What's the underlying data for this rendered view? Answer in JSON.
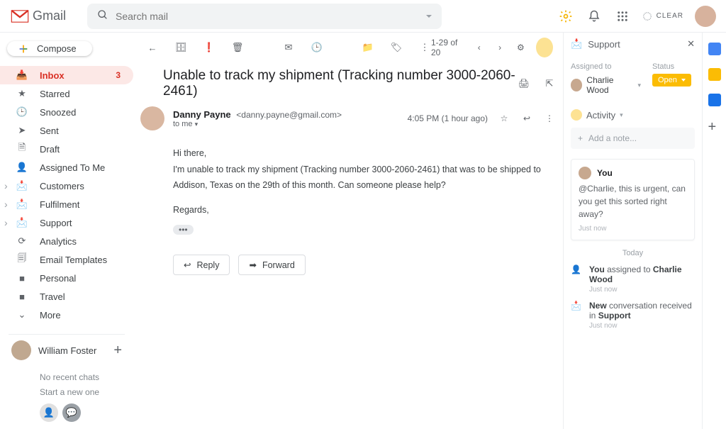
{
  "header": {
    "logo_text": "Gmail",
    "search_placeholder": "Search mail",
    "clear_label": "CLEAR"
  },
  "compose_label": "Compose",
  "sidebar": {
    "items": [
      {
        "label": "Inbox",
        "count": "3"
      },
      {
        "label": "Starred"
      },
      {
        "label": "Snoozed"
      },
      {
        "label": "Sent"
      },
      {
        "label": "Draft"
      },
      {
        "label": "Assigned To Me"
      },
      {
        "label": "Customers"
      },
      {
        "label": "Fulfilment"
      },
      {
        "label": "Support"
      },
      {
        "label": "Analytics"
      },
      {
        "label": "Email Templates"
      },
      {
        "label": "Personal"
      },
      {
        "label": "Travel"
      },
      {
        "label": "More"
      }
    ],
    "profile_name": "William Foster",
    "chats_line1": "No recent chats",
    "chats_line2": "Start a new one"
  },
  "toolbar": {
    "count_text": "1-29 of 20"
  },
  "message": {
    "subject": "Unable to track my shipment (Tracking number 3000-2060-2461)",
    "sender_name": "Danny Payne",
    "sender_email": "<danny.payne@gmail.com>",
    "to_line": "to me",
    "time_text": "4:05 PM (1 hour ago)",
    "body_greeting": "Hi there,",
    "body_main": "I'm unable to track my shipment (Tracking number 3000-2060-2461) that was to be shipped to Addison, Texas on the 29th of this month. Can someone please help?",
    "body_signoff": "Regards,",
    "reply_label": "Reply",
    "forward_label": "Forward"
  },
  "support": {
    "header": "Support",
    "assigned_to_label": "Assigned to",
    "assignee": "Charlie Wood",
    "status_label": "Status",
    "status_value": "Open",
    "activity_label": "Activity",
    "add_note_placeholder": "Add a note...",
    "note_author": "You",
    "note_body": "@Charlie, this is urgent, can you get this sorted right away?",
    "note_time": "Just now",
    "today_label": "Today",
    "feed1_actor": "You",
    "feed1_middle": " assigned to ",
    "feed1_target": "Charlie Wood",
    "feed1_time": "Just now",
    "feed2_actor": "New",
    "feed2_rest": " conversation received in ",
    "feed2_target": "Support",
    "feed2_time": "Just now"
  }
}
